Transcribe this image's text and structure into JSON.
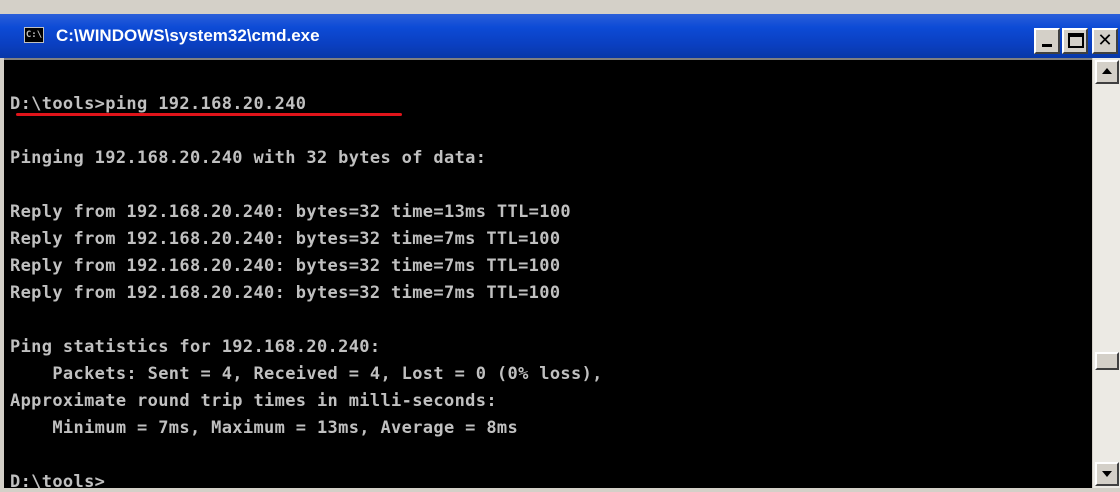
{
  "window": {
    "title": "C:\\WINDOWS\\system32\\cmd.exe",
    "icon_label": "C:\\",
    "title_bar_color": "#0a3fc0",
    "underline_color": "#e0141a"
  },
  "controls": {
    "minimize": "minimize",
    "maximize": "maximize",
    "close": "close"
  },
  "console": {
    "lines": [
      "",
      "D:\\tools>ping 192.168.20.240",
      "",
      "Pinging 192.168.20.240 with 32 bytes of data:",
      "",
      "Reply from 192.168.20.240: bytes=32 time=13ms TTL=100",
      "Reply from 192.168.20.240: bytes=32 time=7ms TTL=100",
      "Reply from 192.168.20.240: bytes=32 time=7ms TTL=100",
      "Reply from 192.168.20.240: bytes=32 time=7ms TTL=100",
      "",
      "Ping statistics for 192.168.20.240:",
      "    Packets: Sent = 4, Received = 4, Lost = 0 (0% loss),",
      "Approximate round trip times in milli-seconds:",
      "    Minimum = 7ms, Maximum = 13ms, Average = 8ms",
      "",
      "D:\\tools>"
    ]
  }
}
